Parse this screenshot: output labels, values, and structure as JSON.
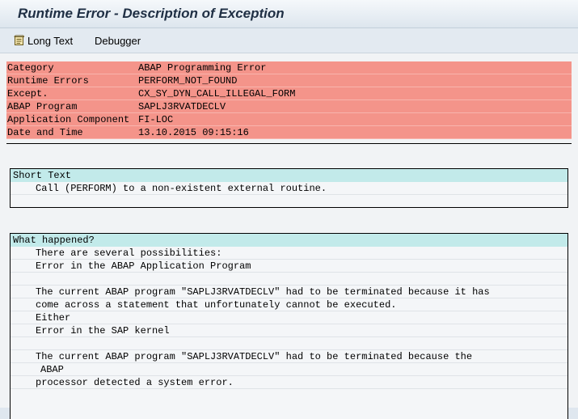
{
  "window": {
    "title": "Runtime Error - Description of Exception"
  },
  "toolbar": {
    "long_text_label": "Long Text",
    "debugger_label": "Debugger"
  },
  "header": {
    "rows": [
      {
        "key": "Category",
        "value": "ABAP Programming Error"
      },
      {
        "key": "Runtime Errors",
        "value": "PERFORM_NOT_FOUND"
      },
      {
        "key": "Except.",
        "value": "CX_SY_DYN_CALL_ILLEGAL_FORM"
      },
      {
        "key": "ABAP Program",
        "value": "SAPLJ3RVATDECLV"
      },
      {
        "key": "Application Component",
        "value": "FI-LOC"
      },
      {
        "key": "Date and Time",
        "value": "13.10.2015 09:15:16"
      }
    ],
    "row_color": "#f4948a"
  },
  "short_text": {
    "heading": "Short Text",
    "lines": [
      "Call (PERFORM) to a non-existent external routine."
    ]
  },
  "what_happened": {
    "heading": "What happened?",
    "lines": [
      "There are several possibilities:",
      "Error in the ABAP Application Program",
      "",
      "The current ABAP program \"SAPLJ3RVATDECLV\" had to be terminated because it has",
      "come across a statement that unfortunately cannot be executed.",
      "Either",
      "Error in the SAP kernel",
      "",
      "The current ABAP program \"SAPLJ3RVATDECLV\" had to be terminated because the",
      "ABAP",
      "processor detected a system error."
    ]
  },
  "section_head_color": "#c2eaea"
}
